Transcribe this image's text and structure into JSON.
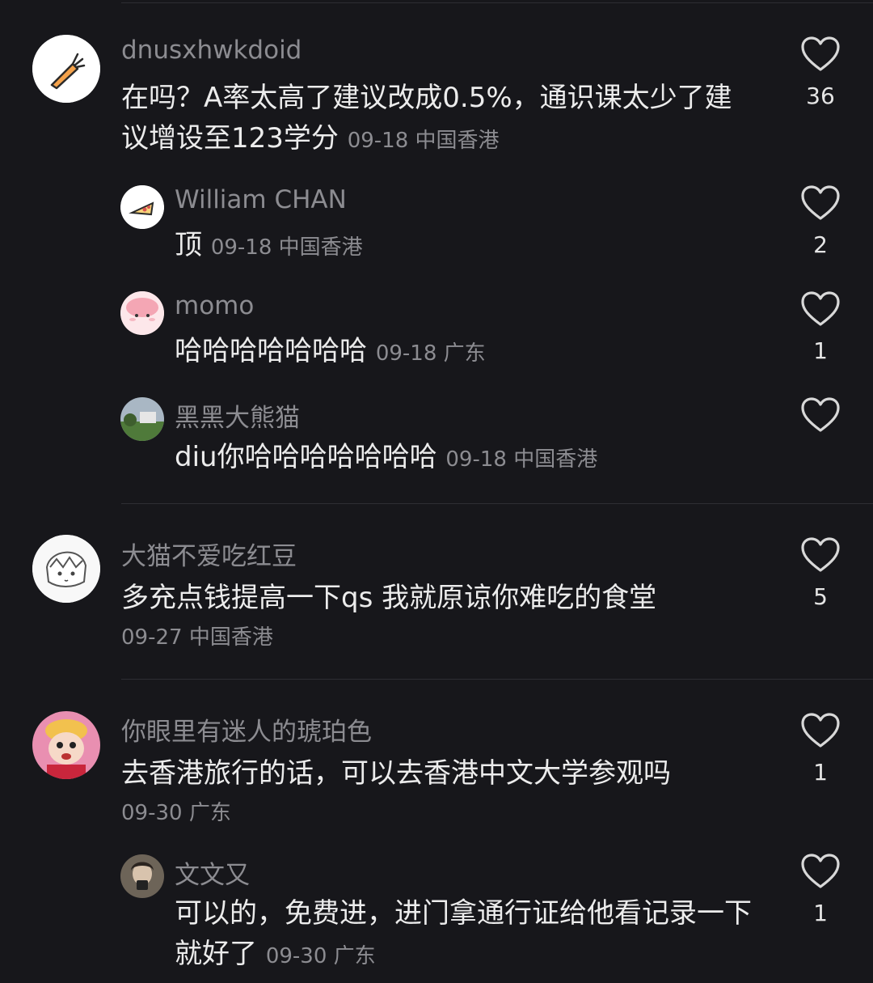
{
  "comments": [
    {
      "user": "dnusxhwkdoid",
      "avatar_icon": "carrot-icon",
      "text": "在吗？A率太高了建议改成0.5%，通识课太少了建议增设至123学分",
      "meta": "09-18 中国香港",
      "likes": "36",
      "replies": [
        {
          "user": "William CHAN",
          "avatar_icon": "pizza-icon",
          "text": "顶",
          "meta": "09-18 中国香港",
          "likes": "2"
        },
        {
          "user": "momo",
          "avatar_icon": "pink-blob-avatar",
          "text": "哈哈哈哈哈哈哈",
          "meta": "09-18 广东",
          "likes": "1"
        },
        {
          "user": "黑黑大熊猫",
          "avatar_icon": "landscape-avatar",
          "text": "diu你哈哈哈哈哈哈哈",
          "meta": "09-18 中国香港",
          "likes": ""
        }
      ]
    },
    {
      "user": "大猫不爱吃红豆",
      "avatar_icon": "anime-sketch-avatar",
      "text": "多充点钱提高一下qs 我就原谅你难吃的食堂",
      "meta": "09-27 中国香港",
      "likes": "5",
      "replies": []
    },
    {
      "user": "你眼里有迷人的琥珀色",
      "avatar_icon": "puppet-avatar",
      "text": "去香港旅行的话，可以去香港中文大学参观吗",
      "meta": "09-30 广东",
      "likes": "1",
      "replies": [
        {
          "user": "文文又",
          "avatar_icon": "selfie-avatar",
          "text": "可以的，免费进，进门拿通行证给他看记录一下就好了",
          "meta": "09-30 广东",
          "likes": "1"
        }
      ]
    }
  ],
  "colors": {
    "background": "#17171b",
    "username": "#8c8c91",
    "text": "#ececec",
    "divider": "#2e2e33"
  }
}
